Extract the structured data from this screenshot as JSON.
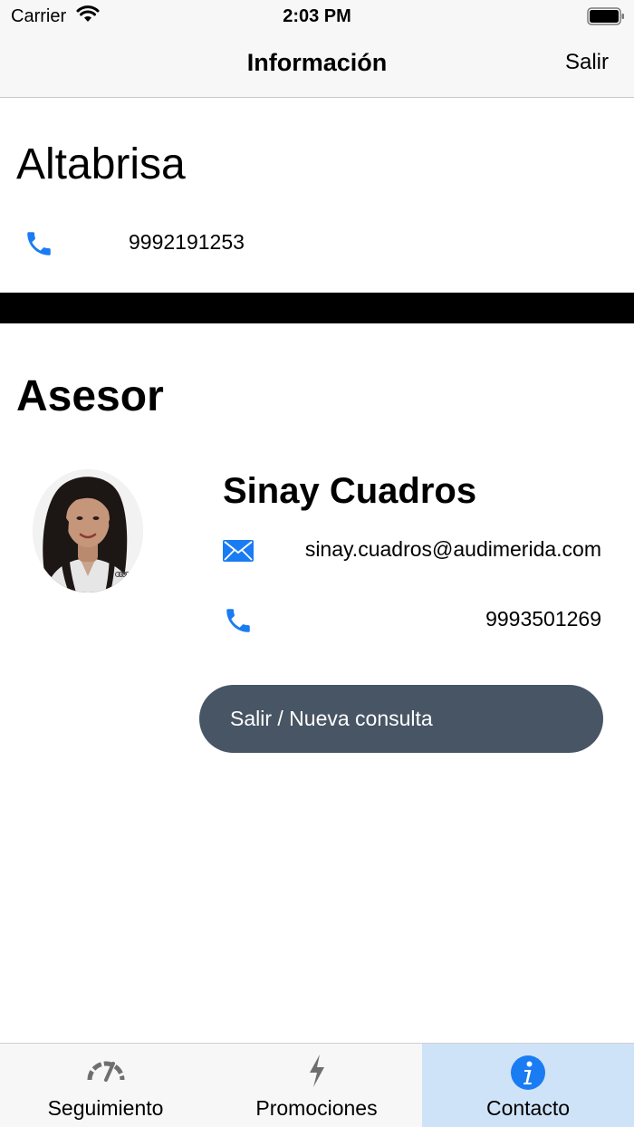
{
  "status_bar": {
    "carrier": "Carrier",
    "time": "2:03 PM"
  },
  "nav": {
    "title": "Información",
    "exit_label": "Salir"
  },
  "dealer": {
    "name": "Altabrisa",
    "phone": "9992191253"
  },
  "advisor": {
    "heading": "Asesor",
    "name": "Sinay Cuadros",
    "email": "sinay.cuadros@audimerida.com",
    "phone": "9993501269",
    "exit_button_label": "Salir / Nueva consulta"
  },
  "tabs": [
    {
      "label": "Seguimiento",
      "icon": "speedometer-icon",
      "selected": false
    },
    {
      "label": "Promociones",
      "icon": "lightning-icon",
      "selected": false
    },
    {
      "label": "Contacto",
      "icon": "info-icon",
      "selected": true
    }
  ],
  "colors": {
    "accent": "#1a7cf2",
    "button_bg": "#475565",
    "selected_tab_bg": "#cfe3f8",
    "divider": "#000000"
  }
}
